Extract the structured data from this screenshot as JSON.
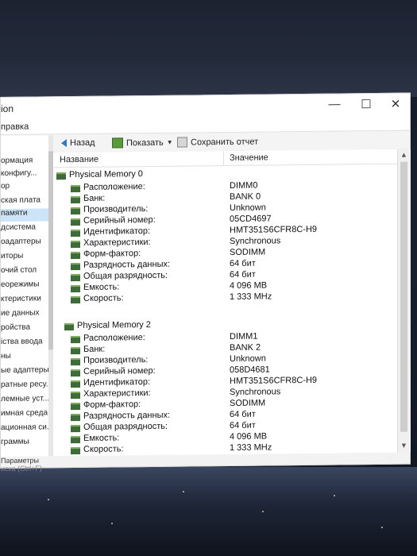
{
  "window": {
    "title": "ion",
    "minimize": "—",
    "maximize": "☐",
    "close": "✕"
  },
  "menu": {
    "item": "правка"
  },
  "sidebar": {
    "items": [
      {
        "label": "ормация"
      },
      {
        "label": "конфигу..."
      },
      {
        "label": "ор"
      },
      {
        "label": "ская плата"
      },
      {
        "label": "памяти",
        "selected": true
      },
      {
        "label": "дсистема"
      },
      {
        "label": "оадаптеры"
      },
      {
        "label": "иторы"
      },
      {
        "label": "очий стол"
      },
      {
        "label": "еорежимы"
      },
      {
        "label": "ктеристики"
      },
      {
        "label": "ие данных"
      },
      {
        "label": "ройства"
      },
      {
        "label": "іства ввода"
      },
      {
        "label": "ны"
      },
      {
        "label": "ые адаптеры"
      },
      {
        "label": "ратные ресу..."
      },
      {
        "label": "лемные уст..."
      },
      {
        "label": "имная среда"
      },
      {
        "label": "ационная си..."
      },
      {
        "label": "граммы"
      }
    ],
    "footer_params": "Параметры",
    "footer_search": "иска (Ctrl+F)"
  },
  "toolbar": {
    "back": "Назад",
    "show": "Показать",
    "save": "Сохранить отчет"
  },
  "table": {
    "col_name": "Название",
    "col_value": "Значение"
  },
  "groups": [
    {
      "title": "Physical Memory 0",
      "props": [
        {
          "k": "Расположение:",
          "v": "DIMM0"
        },
        {
          "k": "Банк:",
          "v": "BANK 0"
        },
        {
          "k": "Производитель:",
          "v": "Unknown"
        },
        {
          "k": "Серийный номер:",
          "v": "05CD4697"
        },
        {
          "k": "Идентификатор:",
          "v": "HMT351S6CFR8C-H9"
        },
        {
          "k": "Характеристики:",
          "v": "Synchronous"
        },
        {
          "k": "Форм-фактор:",
          "v": "SODIMM"
        },
        {
          "k": "Разрядность данных:",
          "v": "64 бит"
        },
        {
          "k": "Общая разрядность:",
          "v": "64 бит"
        },
        {
          "k": "Емкость:",
          "v": "4 096 MB"
        },
        {
          "k": "Скорость:",
          "v": "1 333 MHz"
        }
      ]
    },
    {
      "title": "Physical Memory 2",
      "props": [
        {
          "k": "Расположение:",
          "v": "DIMM1"
        },
        {
          "k": "Банк:",
          "v": "BANK 2"
        },
        {
          "k": "Производитель:",
          "v": "Unknown"
        },
        {
          "k": "Серийный номер:",
          "v": "058D4681"
        },
        {
          "k": "Идентификатор:",
          "v": "HMT351S6CFR8C-H9"
        },
        {
          "k": "Характеристики:",
          "v": "Synchronous"
        },
        {
          "k": "Форм-фактор:",
          "v": "SODIMM"
        },
        {
          "k": "Разрядность данных:",
          "v": "64 бит"
        },
        {
          "k": "Общая разрядность:",
          "v": "64 бит"
        },
        {
          "k": "Емкость:",
          "v": "4 096 MB"
        },
        {
          "k": "Скорость:",
          "v": "1 333 MHz"
        }
      ]
    }
  ]
}
